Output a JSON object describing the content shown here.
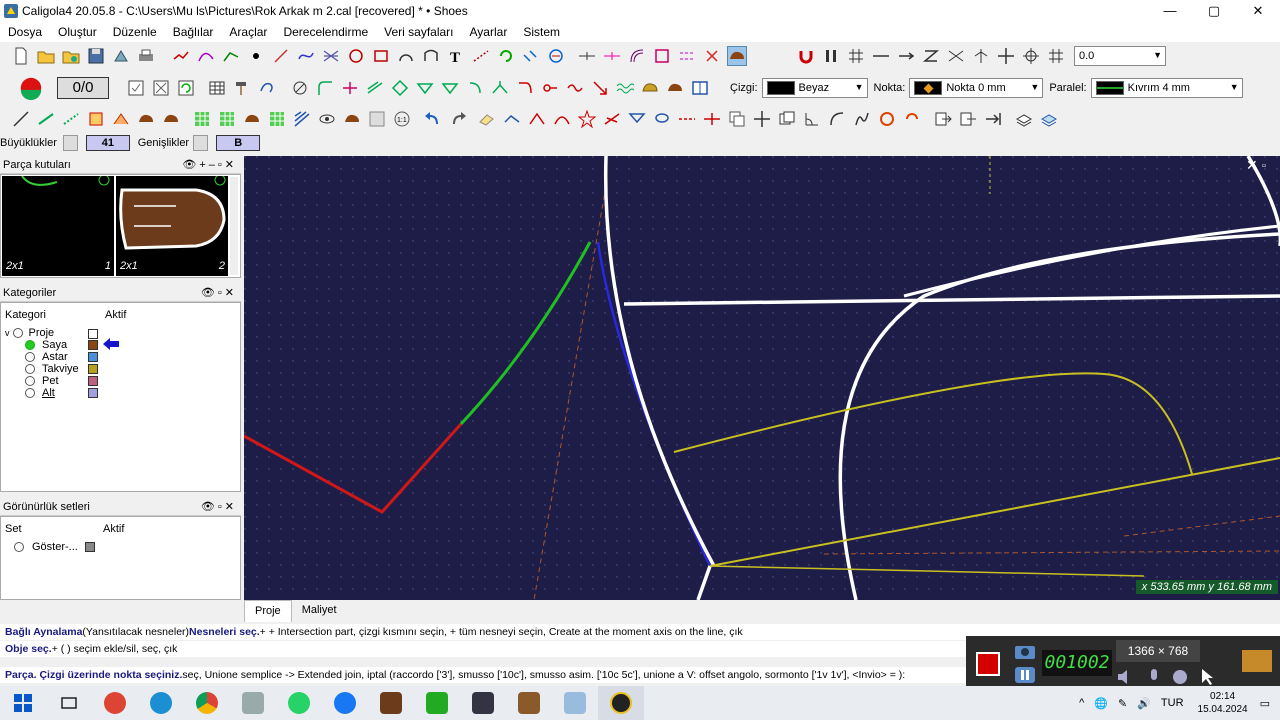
{
  "window": {
    "title": "Caligola4 20.05.8 - C:\\Users\\Mu ls\\Pictures\\Rok Arkak m 2.cal [recovered] * • Shoes",
    "minimize": "—",
    "maximize": "▢",
    "close": "✕"
  },
  "menu": [
    "Dosya",
    "Oluştur",
    "Düzenle",
    "Bağlılar",
    "Araçlar",
    "Derecelendirme",
    "Veri sayfaları",
    "Ayarlar",
    "Sistem"
  ],
  "toolbar1": {
    "value_combo": "0.0"
  },
  "toolbar2": {
    "counter": "0/0",
    "cizgi_label": "Çizgi:",
    "cizgi_value": "Beyaz",
    "nokta_label": "Nokta:",
    "nokta_value": "Nokta 0 mm",
    "paralel_label": "Paralel:",
    "paralel_value": "Kıvrım 4 mm"
  },
  "sizebar": {
    "buyukluk_label": "Büyüklükler",
    "buyukluk_value": "41",
    "genislik_label": "Genişlikler",
    "genislik_value": "B"
  },
  "parts_panel": {
    "title": "Parça kutuları",
    "items": [
      {
        "label": "2x1",
        "number": "1"
      },
      {
        "label": "2x1",
        "number": "2"
      }
    ]
  },
  "categories_panel": {
    "title": "Kategoriler",
    "col_category": "Kategori",
    "col_active": "Aktif",
    "root": "Proje",
    "items": [
      {
        "name": "Saya",
        "color": "#8b4513",
        "selected": true
      },
      {
        "name": "Astar",
        "color": "#4a90d9",
        "selected": false
      },
      {
        "name": "Takviye",
        "color": "#b5a020",
        "selected": false
      },
      {
        "name": "Pet",
        "color": "#c06080",
        "selected": false
      },
      {
        "name": "Alt",
        "color": "#a0a0e0",
        "selected": false
      }
    ]
  },
  "visibility_panel": {
    "title": "Görünürlük setleri",
    "col_set": "Set",
    "col_active": "Aktif",
    "items": [
      {
        "name": "Göster-..."
      }
    ]
  },
  "canvas": {
    "coords": "x 533.65 mm  y 161.68 mm"
  },
  "tabs": [
    "Proje",
    "Maliyet"
  ],
  "status": {
    "line1_bold1": "Bağlı Aynalama",
    "line1_normal1": " (Yansıtılacak nesneler) ",
    "line1_bold2": "Nesneleri seç.",
    "line1_rest": " +  + Intersection part,  çizgi kısmını seçin,  +  tüm nesneyi seçin,  Create at the moment axis on the line,  çık",
    "line2_bold": "Obje seç.",
    "line2_rest": " + ( ) seçim ekle/sil,  seç,  çık",
    "line3_bold": "Parça. Çizgi üzerinde nokta seçiniz.",
    "line3_rest": "  seç,  Unione semplice -> Extended join,  iptal (raccordo ['3'], smusso ['10c'], smusso asim. ['10c 5c'], unione a V: offset angolo, sormonto ['1v 1v'], <Invio> = ):"
  },
  "recorder": {
    "timer": "001002",
    "resolution": "1366 × 768"
  },
  "taskbar": {
    "lang": "TUR",
    "time": "02:14",
    "date": "15.04.2024"
  }
}
